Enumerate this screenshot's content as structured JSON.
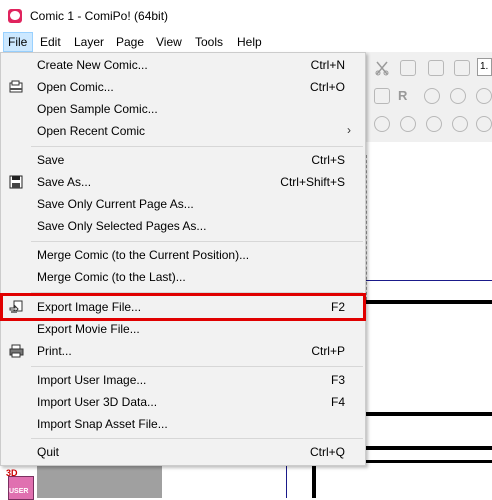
{
  "window": {
    "title": "Comic 1 - ComiPo! (64bit)"
  },
  "menubar": {
    "items": [
      "File",
      "Edit",
      "Layer",
      "Page",
      "View",
      "Tools",
      "Help"
    ]
  },
  "toolbar": {
    "zoom_value": "1."
  },
  "file_menu": {
    "items": [
      {
        "label": "Create New Comic...",
        "shortcut": "Ctrl+N"
      },
      {
        "label": "Open Comic...",
        "shortcut": "Ctrl+O",
        "icon": "open-folder-icon"
      },
      {
        "label": "Open Sample Comic...",
        "shortcut": ""
      },
      {
        "label": "Open Recent Comic",
        "shortcut": "",
        "submenu_arrow": "›"
      },
      {
        "label": "Save",
        "shortcut": "Ctrl+S"
      },
      {
        "label": "Save As...",
        "shortcut": "Ctrl+Shift+S",
        "icon": "floppy-disk-icon"
      },
      {
        "label": "Save Only Current Page As...",
        "shortcut": ""
      },
      {
        "label": "Save Only Selected Pages As...",
        "shortcut": ""
      },
      {
        "label": "Merge Comic (to the Current Position)...",
        "shortcut": ""
      },
      {
        "label": "Merge Comic (to the Last)...",
        "shortcut": ""
      },
      {
        "label": "Export Image File...",
        "shortcut": "F2",
        "icon": "export-image-icon",
        "highlighted": true
      },
      {
        "label": "Export Movie File...",
        "shortcut": ""
      },
      {
        "label": "Print...",
        "shortcut": "Ctrl+P",
        "icon": "printer-icon"
      },
      {
        "label": "Import User Image...",
        "shortcut": "F3"
      },
      {
        "label": "Import User 3D Data...",
        "shortcut": "F4"
      },
      {
        "label": "Import Snap Asset File...",
        "shortcut": ""
      },
      {
        "label": "Quit",
        "shortcut": "Ctrl+Q"
      }
    ]
  },
  "user_icon": {
    "badge": "3D",
    "label": "USER"
  },
  "colors": {
    "highlight_border": "#e00000",
    "menu_bg": "#f2f2f2",
    "active_menu": "#cce8ff"
  }
}
